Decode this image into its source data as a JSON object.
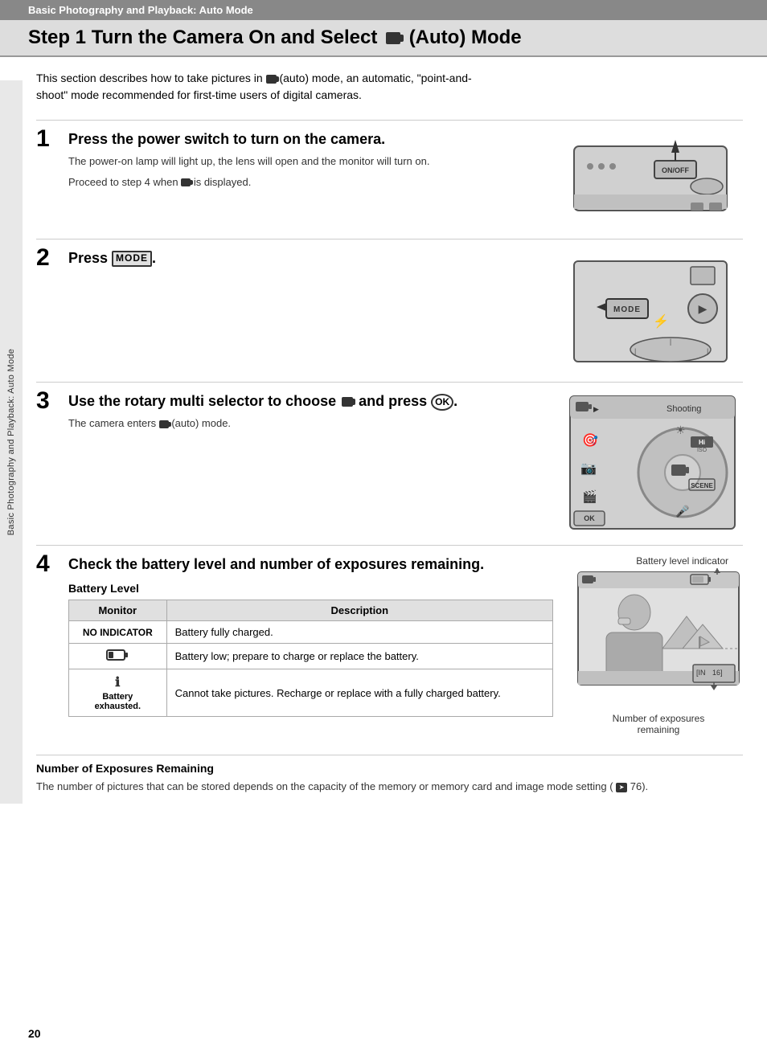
{
  "header": {
    "section_label": "Basic Photography and Playback: Auto Mode",
    "title": "Step 1 Turn the Camera On and Select",
    "title_suffix": "(Auto) Mode"
  },
  "sidebar": {
    "label": "Basic Photography and Playback: Auto Mode"
  },
  "intro": {
    "text": "This section describes how to take pictures in  (auto) mode, an automatic, “point-and-shoot” mode recommended for first-time users of digital cameras."
  },
  "steps": [
    {
      "number": "1",
      "title": "Press the power switch to turn on the camera.",
      "descriptions": [
        "The power-on lamp will light up, the lens will open and the monitor will turn on.",
        "Proceed to step 4 when  is displayed."
      ]
    },
    {
      "number": "2",
      "title": "Press MODE.",
      "descriptions": []
    },
    {
      "number": "3",
      "title": "Use the rotary multi selector to choose  and press ⒪.",
      "descriptions": [
        "The camera enters  (auto) mode."
      ],
      "shooting_label": "Shooting"
    },
    {
      "number": "4",
      "title": "Check the battery level and number of exposures remaining.",
      "descriptions": []
    }
  ],
  "battery": {
    "section_title": "Battery Level",
    "table": {
      "headers": [
        "Monitor",
        "Description"
      ],
      "rows": [
        {
          "monitor": "NO INDICATOR",
          "monitor_type": "text",
          "description": "Battery fully charged."
        },
        {
          "monitor": "⎓",
          "monitor_type": "icon",
          "description": "Battery low; prepare to charge or replace the battery."
        },
        {
          "monitor": "ℹ\nBattery\nexhausted.",
          "monitor_type": "text-multi",
          "description": "Cannot take pictures. Recharge or replace with a fully charged battery."
        }
      ]
    }
  },
  "exposure": {
    "section_title": "Number of Exposures Remaining",
    "description": "The number of pictures that can be stored depends on the capacity of the memory or memory card and image mode setting (➤ 76)."
  },
  "cam4_annotations": {
    "top": "Battery level indicator",
    "bottom": "Number of exposures\nremaining"
  },
  "page_number": "20"
}
